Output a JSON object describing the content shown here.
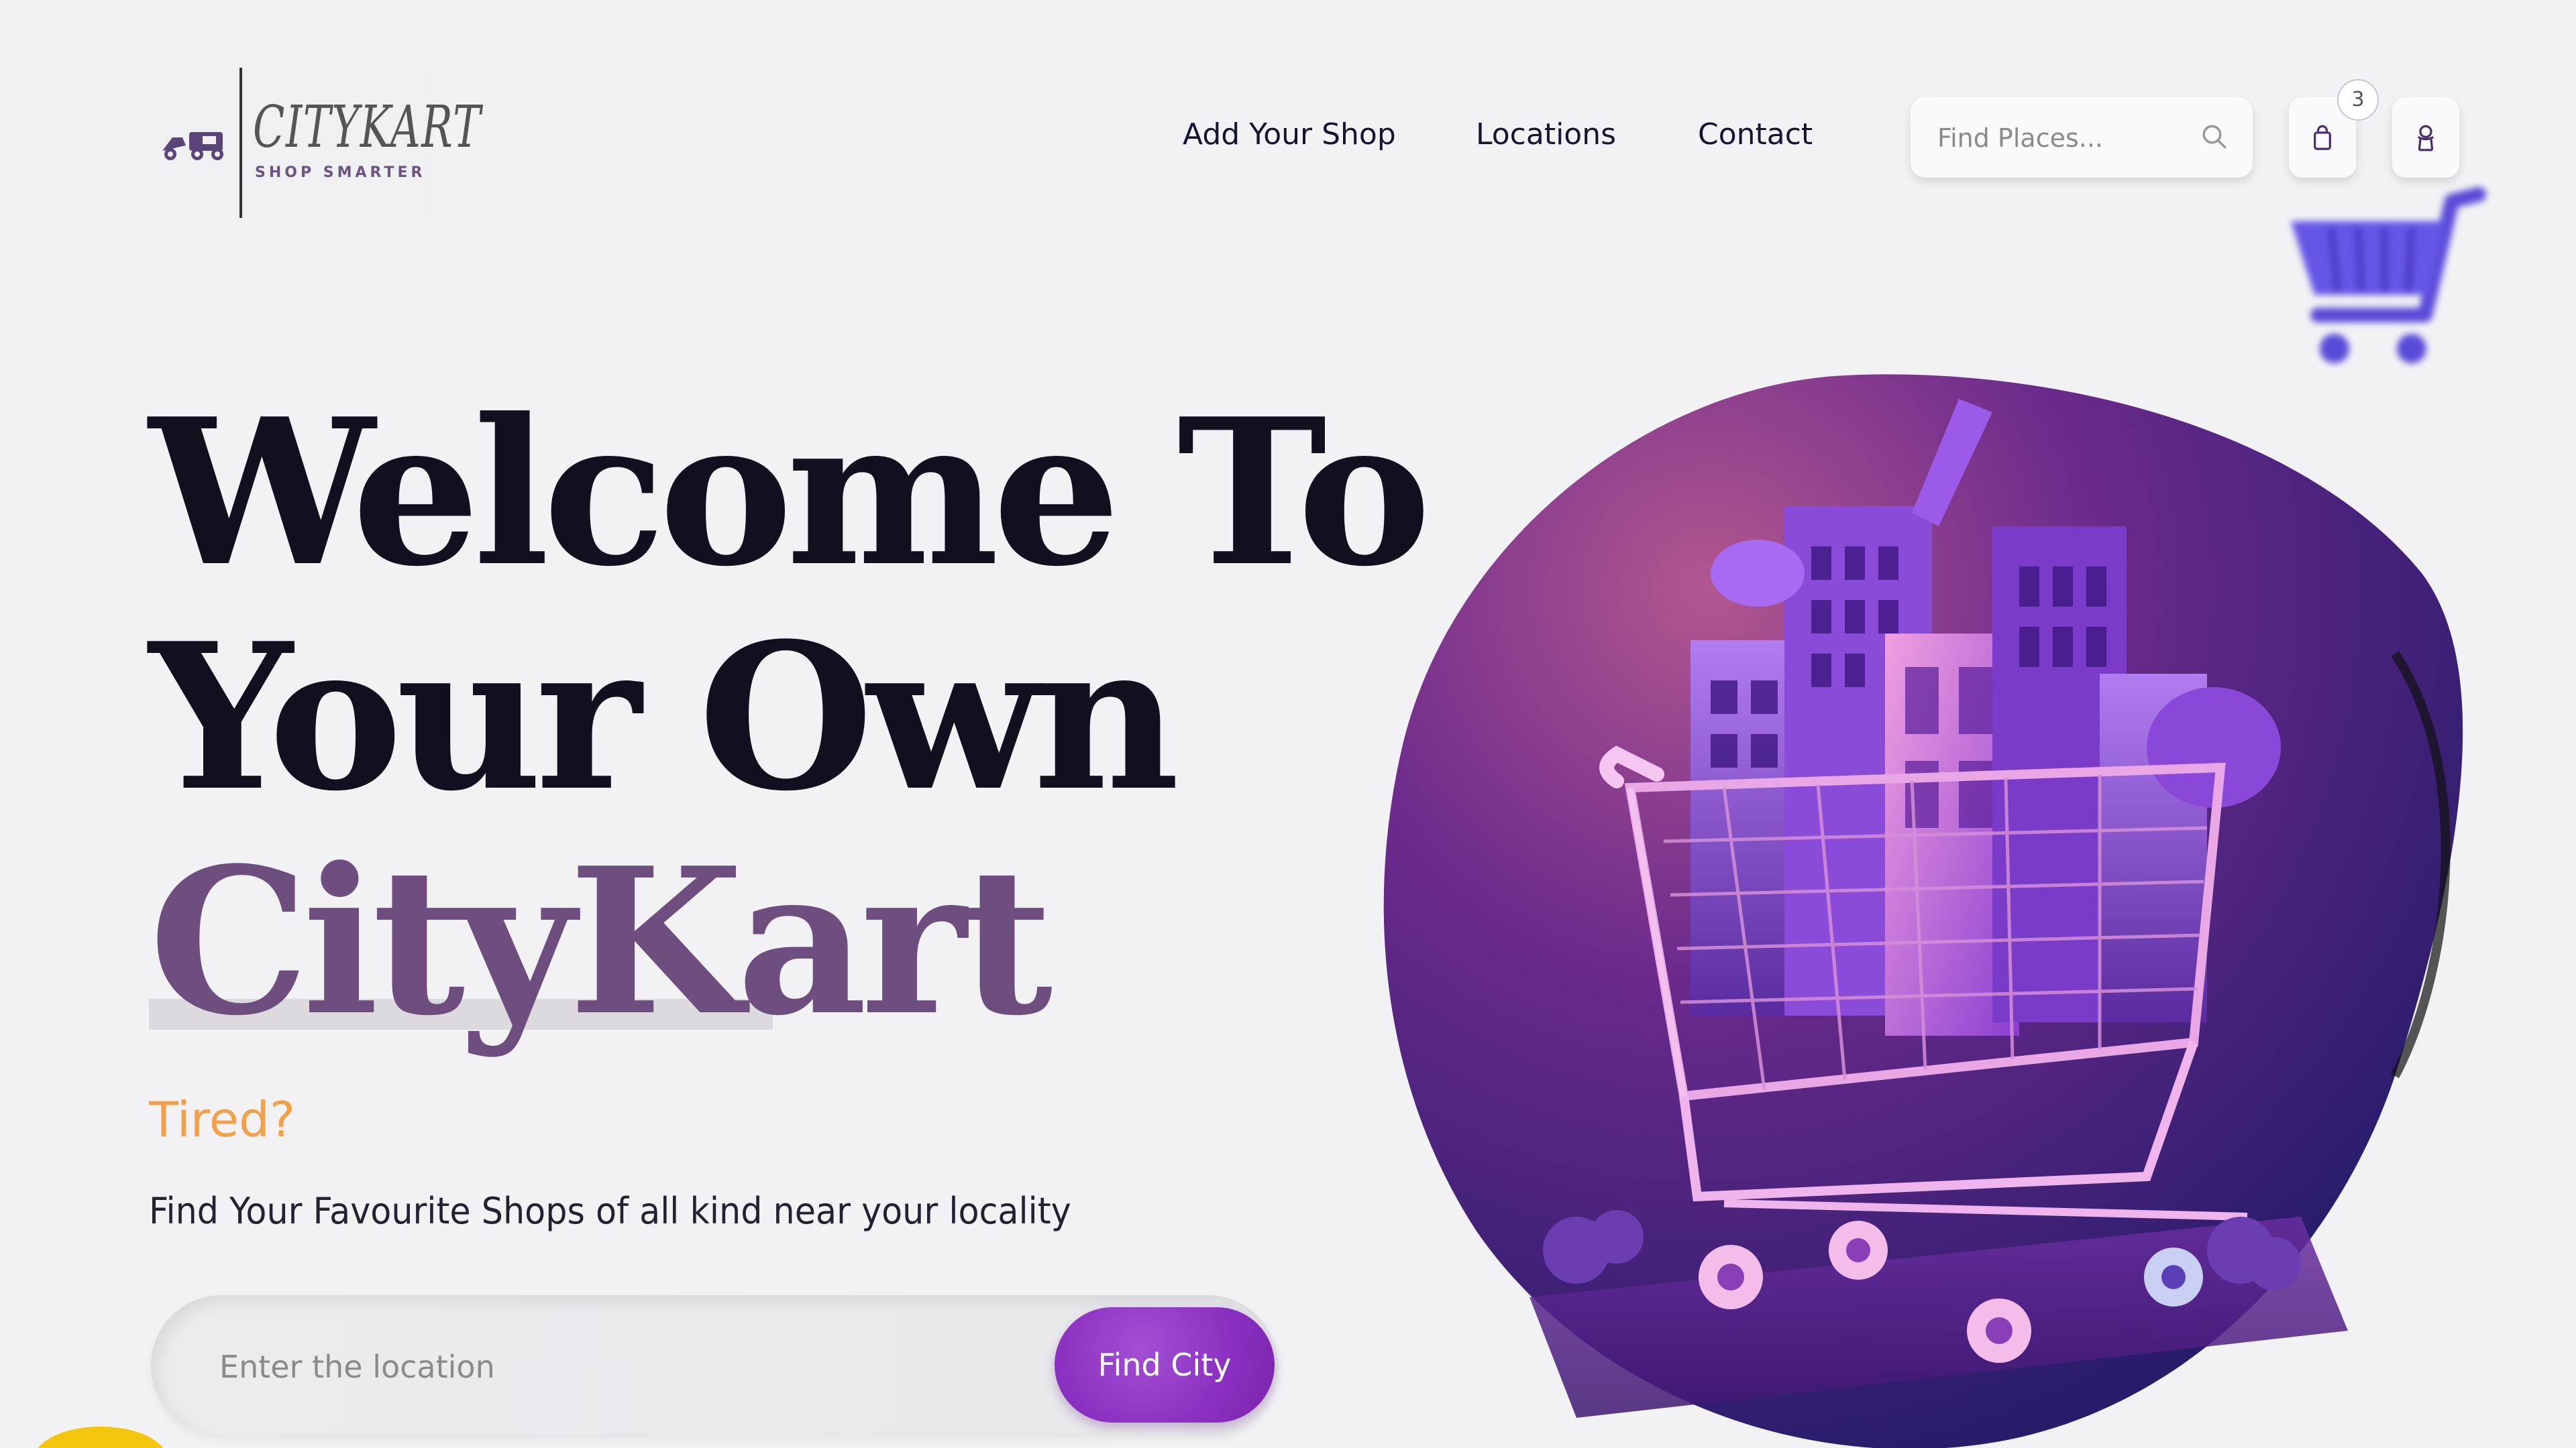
{
  "header": {
    "logo": {
      "brand": "CITYKART",
      "tagline": "SHOP SMARTER"
    },
    "nav": [
      {
        "label": "Add Your Shop"
      },
      {
        "label": "Locations"
      },
      {
        "label": "Contact"
      }
    ],
    "search": {
      "placeholder": "Find Places..."
    },
    "cart": {
      "count": "3"
    }
  },
  "hero": {
    "line1": "Welcome To",
    "line2": "Your Own",
    "brand": "CityKart",
    "tagline": "Tired?",
    "subtitle": "Find Your Favourite Shops of all kind near your locality",
    "location_input": {
      "placeholder": "Enter the location"
    },
    "button_label": "Find City"
  },
  "colors": {
    "background": "#f2f2f5",
    "heading": "#10101e",
    "brand_purple": "#6e4d7f",
    "accent_orange": "#f2a14b",
    "button_purple": "#8a2fc0"
  },
  "icons": [
    "truck-logo-icon",
    "search-icon",
    "shopping-bag-icon",
    "user-icon",
    "shopping-cart-icon"
  ]
}
